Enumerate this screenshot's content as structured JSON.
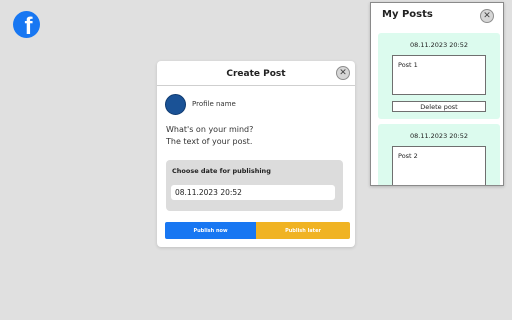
{
  "logo": {
    "letter": "f",
    "color": "#1877f2"
  },
  "create_post": {
    "title": "Create Post",
    "close_glyph": "✕",
    "profile_name": "Profile name",
    "prompt_line1": "What's on your mind?",
    "prompt_line2": "The text of your post.",
    "date_label": "Choose date for publishing",
    "date_value": "08.11.2023   20:52",
    "publish_now": "Publish now",
    "publish_later": "Publish later"
  },
  "my_posts": {
    "title": "My Posts",
    "close_glyph": "✕",
    "posts": [
      {
        "date": "08.11.2023 20:52",
        "text": "Post 1",
        "delete_label": "Delete post"
      },
      {
        "date": "08.11.2023 20:52",
        "text": "Post 2"
      }
    ]
  },
  "colors": {
    "primary": "#1877f2",
    "accent": "#f0b323",
    "post_card": "#dcfbee",
    "avatar": "#1a5296"
  }
}
